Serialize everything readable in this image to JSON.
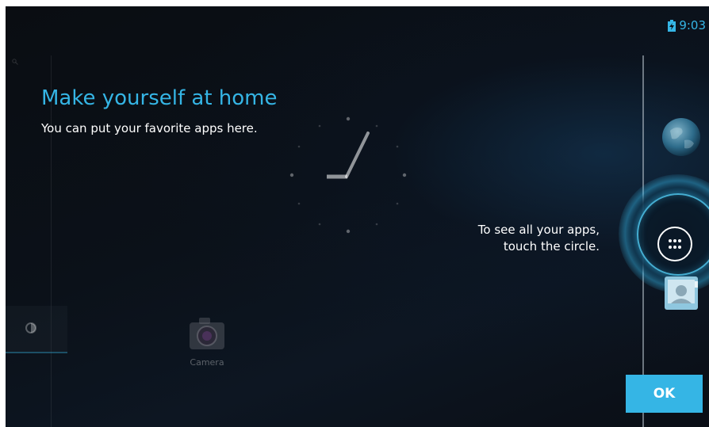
{
  "status_bar": {
    "time": "9:03",
    "battery_icon": "battery-charging-icon"
  },
  "cling": {
    "title": "Make yourself at home",
    "subtitle": "You can put your favorite apps here.",
    "hint_line1": "To see all your apps,",
    "hint_line2": "touch the circle.",
    "ok_label": "OK"
  },
  "workspace": {
    "camera_label": "Camera",
    "all_apps_icon": "all-apps-grid-icon"
  },
  "colors": {
    "accent": "#35b5e5",
    "background": "#0b1119",
    "text": "#ffffff"
  }
}
